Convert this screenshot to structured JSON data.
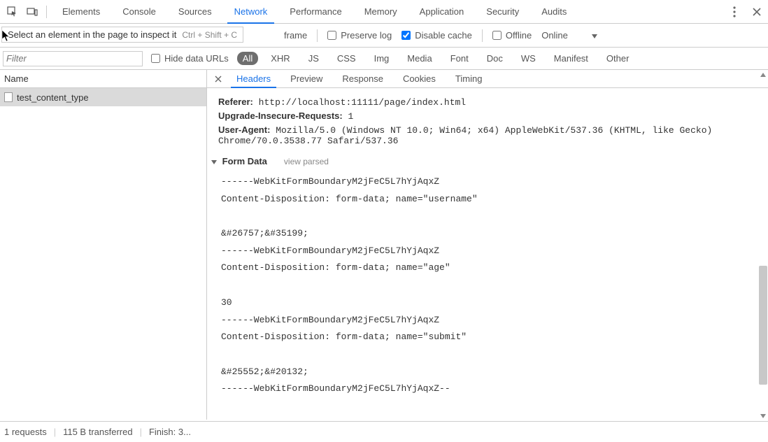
{
  "mainTabs": {
    "items": [
      "Elements",
      "Console",
      "Sources",
      "Network",
      "Performance",
      "Memory",
      "Application",
      "Security",
      "Audits"
    ],
    "activeIndex": 3
  },
  "tooltip": {
    "text": "Select an element in the page to inspect it",
    "shortcut": "Ctrl + Shift + C"
  },
  "subtoolbar": {
    "frameText": "frame",
    "preserveLog": "Preserve log",
    "disableCache": "Disable cache",
    "offline": "Offline",
    "throttling": "Online"
  },
  "filterbar": {
    "filterPlaceholder": "Filter",
    "hideDataUrls": "Hide data URLs",
    "chips": [
      "All",
      "XHR",
      "JS",
      "CSS",
      "Img",
      "Media",
      "Font",
      "Doc",
      "WS",
      "Manifest",
      "Other"
    ],
    "activeChipIndex": 0
  },
  "leftPane": {
    "header": "Name",
    "rows": [
      {
        "name": "test_content_type",
        "selected": true
      }
    ]
  },
  "rightTabs": {
    "items": [
      "Headers",
      "Preview",
      "Response",
      "Cookies",
      "Timing"
    ],
    "activeIndex": 0
  },
  "headersTop": [
    {
      "k": "Referer",
      "v": "http://localhost:11111/page/index.html"
    },
    {
      "k": "Upgrade-Insecure-Requests",
      "v": "1"
    },
    {
      "k": "User-Agent",
      "v": "Mozilla/5.0 (Windows NT 10.0; Win64; x64) AppleWebKit/537.36 (KHTML, like Gecko) Chrome/70.0.3538.77 Safari/537.36"
    }
  ],
  "formDataSection": {
    "title": "Form Data",
    "link": "view parsed",
    "body": "------WebKitFormBoundaryM2jFeC5L7hYjAqxZ\nContent-Disposition: form-data; name=\"username\"\n\n&#26757;&#35199;\n------WebKitFormBoundaryM2jFeC5L7hYjAqxZ\nContent-Disposition: form-data; name=\"age\"\n\n30\n------WebKitFormBoundaryM2jFeC5L7hYjAqxZ\nContent-Disposition: form-data; name=\"submit\"\n\n&#25552;&#20132;\n------WebKitFormBoundaryM2jFeC5L7hYjAqxZ--"
  },
  "statusbar": {
    "requests": "1 requests",
    "transferred": "115 B transferred",
    "finish": "Finish: 3..."
  }
}
